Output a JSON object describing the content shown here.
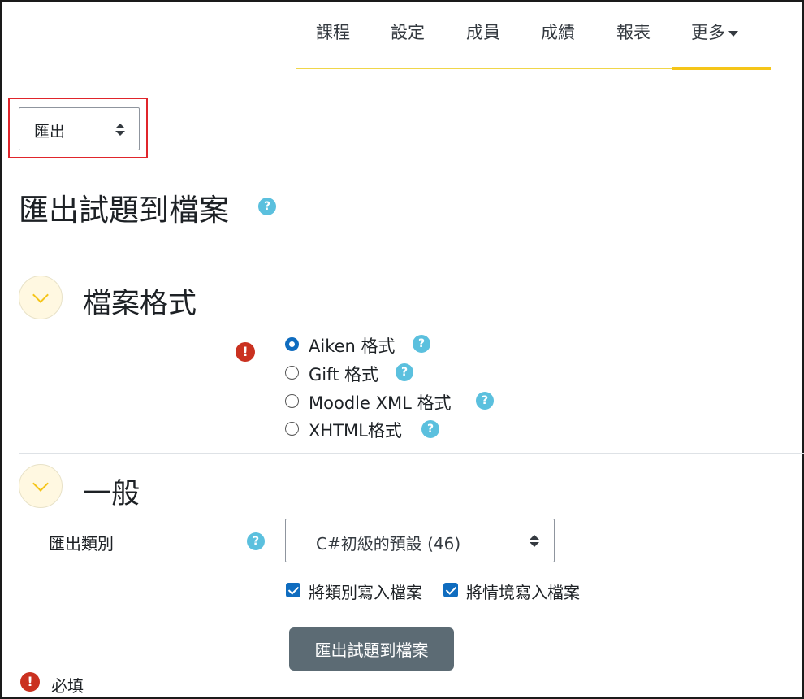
{
  "nav": {
    "items": [
      {
        "label": "課程"
      },
      {
        "label": "設定"
      },
      {
        "label": "成員"
      },
      {
        "label": "成績"
      },
      {
        "label": "報表"
      },
      {
        "label": "更多"
      }
    ],
    "active_index": 5
  },
  "jump_select": {
    "value": "匯出"
  },
  "page": {
    "title": "匯出試題到檔案"
  },
  "sections": {
    "file_format": {
      "title": "檔案格式",
      "options": [
        {
          "label": "Aiken 格式",
          "checked": true
        },
        {
          "label": "Gift 格式",
          "checked": false
        },
        {
          "label": "Moodle XML 格式",
          "checked": false
        },
        {
          "label": "XHTML格式",
          "checked": false
        }
      ]
    },
    "general": {
      "title": "一般",
      "category_label": "匯出類別",
      "category_value": "C#初級的預設 (46)",
      "write_category": {
        "label": "將類別寫入檔案",
        "checked": true
      },
      "write_context": {
        "label": "將情境寫入檔案",
        "checked": true
      }
    }
  },
  "submit": {
    "label": "匯出試題到檔案"
  },
  "required_note": "必填",
  "icons": {
    "help": "?",
    "required": "!"
  },
  "colors": {
    "accent_yellow": "#f5c518",
    "help_blue": "#5bc0de",
    "required_red": "#ca3120",
    "primary_blue": "#0f6cbf",
    "button_gray": "#5c6b74",
    "highlight_red": "#e0252b"
  }
}
